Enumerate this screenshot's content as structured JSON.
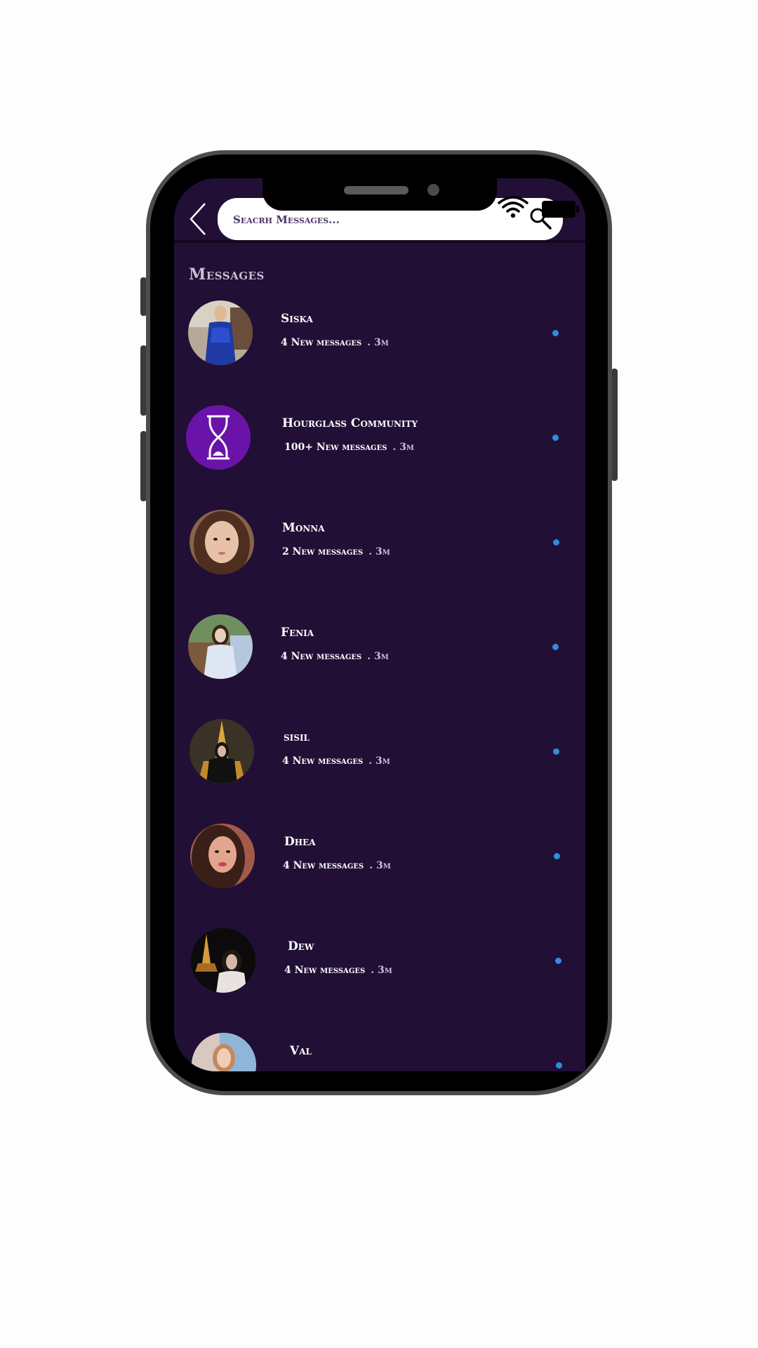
{
  "search": {
    "placeholder": "Seacrh Messages..."
  },
  "page": {
    "title": "Messages"
  },
  "icons": {
    "back": "chevron-left-icon",
    "search": "search-icon",
    "wifi": "wifi-icon",
    "battery": "battery-icon"
  },
  "colors": {
    "background": "#210f36",
    "unread_dot": "#2f8de0",
    "community_avatar": "#6a13a8"
  },
  "conversations": [
    {
      "name": "Siska",
      "messages": "4 New messages",
      "time": ". 3m"
    },
    {
      "name": "Hourglass Community",
      "messages": "100+ New messages",
      "time": ". 3m"
    },
    {
      "name": "Monna",
      "messages": "2 New messages",
      "time": ". 3m"
    },
    {
      "name": "Fenia",
      "messages": "4 New messages",
      "time": ". 3m"
    },
    {
      "name": "sisil",
      "messages": "4 New messages",
      "time": ". 3m"
    },
    {
      "name": "Dhea",
      "messages": "4 New messages",
      "time": ". 3m"
    },
    {
      "name": "Dew",
      "messages": "4 New messages",
      "time": ". 3m"
    },
    {
      "name": "Val"
    }
  ]
}
